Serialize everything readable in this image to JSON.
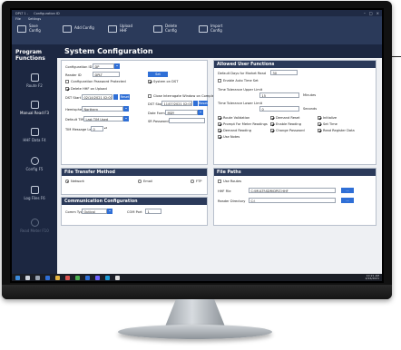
{
  "titlebar": {
    "title": "DPLT 1 -",
    "doc": "Configuration ID"
  },
  "ribbon": {
    "menus": [
      "File",
      "Settings"
    ],
    "buttons": [
      "Save Config",
      "Add Config",
      "Upload HHF",
      "Delete Config",
      "Import Config"
    ]
  },
  "nav": {
    "heading": "Program Functions",
    "items": [
      {
        "label": "Route F2",
        "icon": "route-icon"
      },
      {
        "label": "Manual Read F3",
        "icon": "manual-read-icon"
      },
      {
        "label": "HHF Data F4",
        "icon": "hhf-data-icon"
      },
      {
        "label": "Config F5",
        "icon": "gear-icon"
      },
      {
        "label": "Log Files F6",
        "icon": "log-files-icon"
      },
      {
        "label": "Read Meter F10",
        "icon": "read-meter-icon"
      }
    ]
  },
  "page_title": "System Configuration",
  "config": {
    "config_id_label": "Configuration ID",
    "config_id": "DP",
    "reader_id_label": "Reader ID",
    "reader_id": "DPLT",
    "set_password": "Set Password",
    "config_pw_protected": "Configuration Password Protected",
    "system_on_dst": "System on DST",
    "delete_hhf": "Delete HHF on Upload",
    "close_window": "Close Interrogate Window on Completion",
    "dst_start_label": "DST Start",
    "dst_start": "02/14/2021 02:00",
    "dst_stop_label": "DST Stop",
    "dst_stop": "11/07/2021 02:00",
    "reset": "Reset",
    "hemisphere_label": "Hemisphere",
    "hemisphere": "Northern",
    "date_format_label": "Date Format",
    "date_format": "MDY",
    "default_tim_label": "Default TIM",
    "default_tim": "Last TIM Used",
    "sr_password_label": "SR Password",
    "tim_level_label": "TIM Message Level",
    "tim_level": "0"
  },
  "allowed": {
    "title": "Allowed User Functions",
    "default_days_label": "Default Days for Market Read",
    "default_days": "30",
    "enable_auto": "Enable Auto Time Set",
    "upper_label": "Time Tolerance Upper Limit",
    "upper": "15",
    "minutes": "Minutes",
    "lower_label": "Time Tolerance Lower Limit",
    "lower": "0",
    "seconds": "Seconds",
    "checks": [
      "Route Validation",
      "Demand Reset",
      "Initialize",
      "Prompt For Meter Readings",
      "Enable Reading",
      "Set Time",
      "Demand Reading",
      "Change Password",
      "Read Register Data",
      "Use Notes"
    ]
  },
  "transfer": {
    "title": "File Transfer Method",
    "network": "Network",
    "email": "Email",
    "ftp": "FTP"
  },
  "comm": {
    "title": "Communication Configuration",
    "comm_type_label": "Comm Type",
    "comm_type": "Optical",
    "com_port_label": "COM Port",
    "com_port": "1"
  },
  "paths": {
    "title": "File Paths",
    "use_routes": "Use Routes",
    "hhf_label": "HHF File",
    "hhf": "C:\\MULTI\\SDR\\DPLT.HHF",
    "reader_dir_label": "Reader Directory",
    "reader_dir": "C:\\",
    "browse": "..."
  },
  "taskbar": {
    "time": "10:21 AM",
    "date": "2/16/2021"
  },
  "colors": {
    "nav": "#1c2741",
    "ribbon": "#2b3a5a",
    "accent": "#2f6fd6"
  }
}
